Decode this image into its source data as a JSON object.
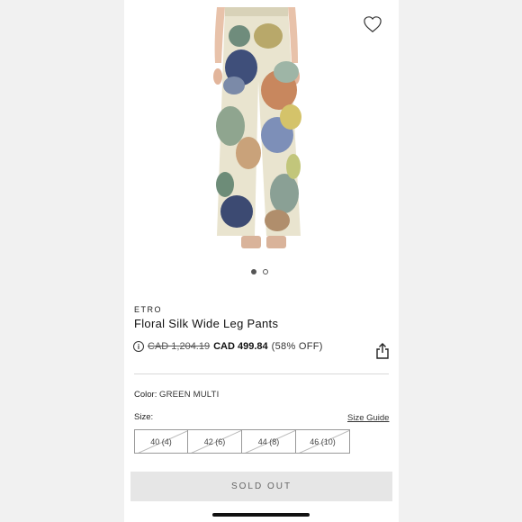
{
  "product": {
    "brand": "ETRO",
    "name": "Floral Silk Wide Leg Pants",
    "original_price": "CAD 1,204.19",
    "sale_price": "CAD 499.84",
    "discount": "(58% OFF)",
    "color_label": "Color:",
    "color_value": "GREEN MULTI",
    "size_label": "Size:",
    "size_guide": "Size Guide",
    "sizes": [
      "40 (4)",
      "42 (6)",
      "44 (8)",
      "46 (10)"
    ]
  },
  "gallery": {
    "image_count": 2,
    "active_index": 0
  },
  "actions": {
    "sold_out": "SOLD OUT"
  },
  "icons": {
    "wishlist": "heart-icon",
    "share": "share-icon",
    "info": "info-icon"
  }
}
